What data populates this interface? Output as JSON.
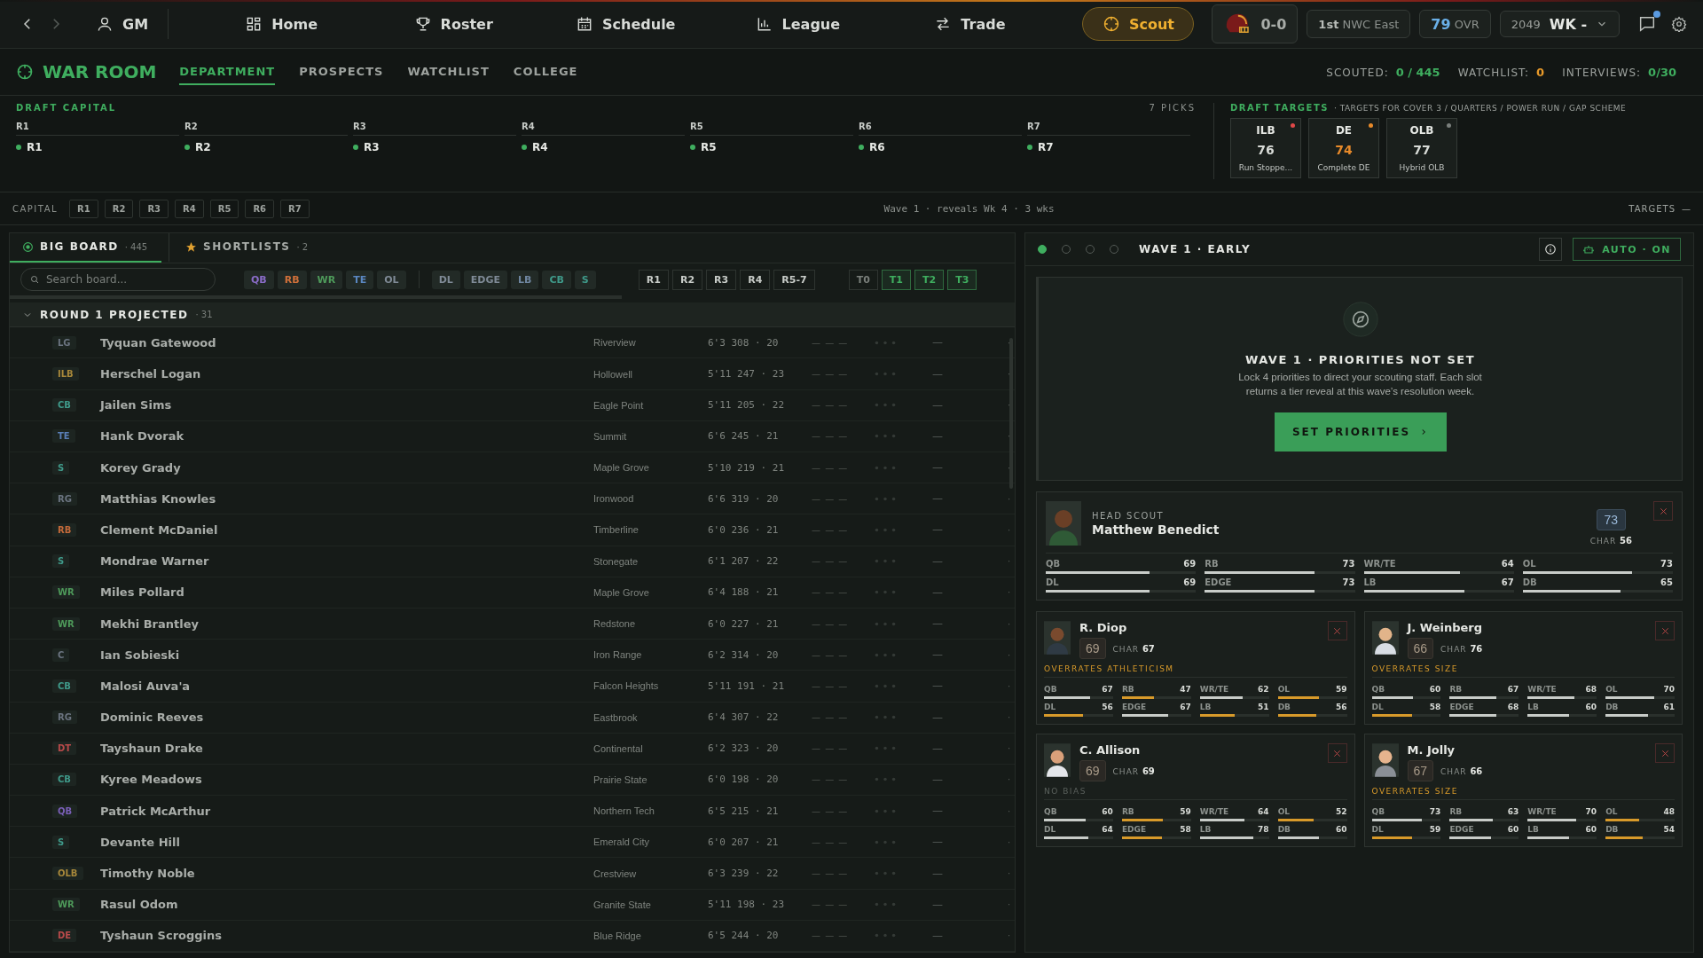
{
  "nav": {
    "items": [
      {
        "label": "GM",
        "selected": false
      },
      {
        "label": "Home",
        "selected": false
      },
      {
        "label": "Roster",
        "selected": false
      },
      {
        "label": "Schedule",
        "selected": false
      },
      {
        "label": "League",
        "selected": false
      },
      {
        "label": "Trade",
        "selected": false
      },
      {
        "label": "Scout",
        "selected": true
      }
    ],
    "record": "0-0",
    "standing": "1st",
    "division": "NWC East",
    "ovr": "79",
    "ovr_label": "OVR",
    "year": "2049",
    "week": "WK -",
    "unread": true
  },
  "war_room": {
    "title": "WAR ROOM",
    "tabs": [
      {
        "label": "DEPARTMENT",
        "selected": true
      },
      {
        "label": "PROSPECTS",
        "selected": false
      },
      {
        "label": "WATCHLIST",
        "selected": false
      },
      {
        "label": "COLLEGE",
        "selected": false
      }
    ],
    "stats": [
      {
        "label": "SCOUTED:",
        "value": "0 / 445",
        "color": "#3fae5f"
      },
      {
        "label": "WATCHLIST:",
        "value": "0",
        "color": "#e89a2a"
      },
      {
        "label": "INTERVIEWS:",
        "value": "0/30",
        "color": "#3fae5f"
      }
    ]
  },
  "draft_capital": {
    "title": "DRAFT CAPITAL",
    "count": "7 PICKS",
    "rounds": [
      {
        "round": "R1",
        "pick": "R1"
      },
      {
        "round": "R2",
        "pick": "R2"
      },
      {
        "round": "R3",
        "pick": "R3"
      },
      {
        "round": "R4",
        "pick": "R4"
      },
      {
        "round": "R5",
        "pick": "R5"
      },
      {
        "round": "R6",
        "pick": "R6"
      },
      {
        "round": "R7",
        "pick": "R7"
      }
    ]
  },
  "draft_targets": {
    "title": "DRAFT TARGETS",
    "subtitle": "· TARGETS FOR COVER 3 / QUARTERS / POWER RUN / GAP SCHEME",
    "targets": [
      {
        "position": "ILB",
        "rating": "76",
        "label": "Run Stoppe...",
        "color": "#e04848",
        "highlighted": false
      },
      {
        "position": "DE",
        "rating": "74",
        "label": "Complete DE",
        "color": "#e88a2a",
        "highlighted": true
      },
      {
        "position": "OLB",
        "rating": "77",
        "label": "Hybrid OLB",
        "color": "#7a7f7c",
        "highlighted": false
      }
    ]
  },
  "capital_bar": {
    "label": "CAPITAL",
    "chips": [
      "R1",
      "R2",
      "R3",
      "R4",
      "R5",
      "R6",
      "R7"
    ],
    "wave_note": "Wave 1 · reveals Wk 4 · 3 wks",
    "targets_label": "TARGETS",
    "targets_toggle": "—"
  },
  "board": {
    "tabs": [
      {
        "label": "BIG BOARD",
        "count": "· 445",
        "selected": true
      },
      {
        "label": "SHORTLISTS",
        "count": "· 2",
        "selected": false
      }
    ],
    "search": {
      "placeholder": "Search board..."
    },
    "offense_filters": [
      {
        "label": "QB",
        "color": "#8a6cc8"
      },
      {
        "label": "RB",
        "color": "#d0703a"
      },
      {
        "label": "WR",
        "color": "#4e9a5a"
      },
      {
        "label": "TE",
        "color": "#5a86c0"
      },
      {
        "label": "OL",
        "color": "#7f8a96"
      }
    ],
    "defense_filters": [
      {
        "label": "DL",
        "color": "#7f8a96"
      },
      {
        "label": "EDGE",
        "color": "#7f8a96"
      },
      {
        "label": "LB",
        "color": "#6f86a0"
      },
      {
        "label": "CB",
        "color": "#3f9a8a"
      },
      {
        "label": "S",
        "color": "#3f9a8a"
      }
    ],
    "round_filters": [
      "R1",
      "R2",
      "R3",
      "R4",
      "R5-7"
    ],
    "tier_filters": [
      {
        "label": "T0",
        "selected": false
      },
      {
        "label": "T1",
        "selected": true
      },
      {
        "label": "T2",
        "selected": true
      },
      {
        "label": "T3",
        "selected": true
      }
    ],
    "group": {
      "title": "ROUND 1 PROJECTED",
      "count": "· 31",
      "expanded": true
    },
    "players": [
      {
        "pos": "LG",
        "color": "#6b7480",
        "name": "Tyquan Gatewood",
        "school": "Riverview",
        "measurables": "6'3 308 · 20",
        "column_5": "— — —",
        "column_7": "—",
        "column_8": "·"
      },
      {
        "pos": "ILB",
        "color": "#a8883a",
        "name": "Herschel Logan",
        "school": "Hollowell",
        "measurables": "5'11 247 · 23",
        "column_5": "— — —",
        "column_7": "—",
        "column_8": "·"
      },
      {
        "pos": "CB",
        "color": "#3f9a8a",
        "name": "Jailen Sims",
        "school": "Eagle Point",
        "measurables": "5'11 205 · 22",
        "column_5": "— — —",
        "column_7": "—",
        "column_8": "·"
      },
      {
        "pos": "TE",
        "color": "#5a7fb8",
        "name": "Hank Dvorak",
        "school": "Summit",
        "measurables": "6'6 245 · 21",
        "column_5": "— — —",
        "column_7": "—",
        "column_8": "·"
      },
      {
        "pos": "S",
        "color": "#3f9a8a",
        "name": "Korey Grady",
        "school": "Maple Grove",
        "measurables": "5'10 219 · 21",
        "column_5": "— — —",
        "column_7": "—",
        "column_8": "·"
      },
      {
        "pos": "RG",
        "color": "#6b7480",
        "name": "Matthias Knowles",
        "school": "Ironwood",
        "measurables": "6'6 319 · 20",
        "column_5": "— — —",
        "column_7": "—",
        "column_8": "·"
      },
      {
        "pos": "RB",
        "color": "#c46a3a",
        "name": "Clement McDaniel",
        "school": "Timberline",
        "measurables": "6'0 236 · 21",
        "column_5": "— — —",
        "column_7": "—",
        "column_8": "·"
      },
      {
        "pos": "S",
        "color": "#3f9a8a",
        "name": "Mondrae Warner",
        "school": "Stonegate",
        "measurables": "6'1 207 · 22",
        "column_5": "— — —",
        "column_7": "—",
        "column_8": "·"
      },
      {
        "pos": "WR",
        "color": "#4e9a5a",
        "name": "Miles Pollard",
        "school": "Maple Grove",
        "measurables": "6'4 188 · 21",
        "column_5": "— — —",
        "column_7": "—",
        "column_8": "·"
      },
      {
        "pos": "WR",
        "color": "#4e9a5a",
        "name": "Mekhi Brantley",
        "school": "Redstone",
        "measurables": "6'0 227 · 21",
        "column_5": "— — —",
        "column_7": "—",
        "column_8": "·"
      },
      {
        "pos": "C",
        "color": "#6b7480",
        "name": "Ian Sobieski",
        "school": "Iron Range",
        "measurables": "6'2 314 · 20",
        "column_5": "— — —",
        "column_7": "—",
        "column_8": "·"
      },
      {
        "pos": "CB",
        "color": "#3f9a8a",
        "name": "Malosi Auva'a",
        "school": "Falcon Heights",
        "measurables": "5'11 191 · 21",
        "column_5": "— — —",
        "column_7": "—",
        "column_8": "·"
      },
      {
        "pos": "RG",
        "color": "#6b7480",
        "name": "Dominic Reeves",
        "school": "Eastbrook",
        "measurables": "6'4 307 · 22",
        "column_5": "— — —",
        "column_7": "—",
        "column_8": "·"
      },
      {
        "pos": "DT",
        "color": "#b84a4a",
        "name": "Tayshaun Drake",
        "school": "Continental",
        "measurables": "6'2 323 · 20",
        "column_5": "— — —",
        "column_7": "—",
        "column_8": "·"
      },
      {
        "pos": "CB",
        "color": "#3f9a8a",
        "name": "Kyree Meadows",
        "school": "Prairie State",
        "measurables": "6'0 198 · 20",
        "column_5": "— — —",
        "column_7": "—",
        "column_8": "·"
      },
      {
        "pos": "QB",
        "color": "#7a5fb8",
        "name": "Patrick McArthur",
        "school": "Northern Tech",
        "measurables": "6'5 215 · 21",
        "column_5": "— — —",
        "column_7": "—",
        "column_8": "·"
      },
      {
        "pos": "S",
        "color": "#3f9a8a",
        "name": "Devante Hill",
        "school": "Emerald City",
        "measurables": "6'0 207 · 21",
        "column_5": "— — —",
        "column_7": "—",
        "column_8": "·"
      },
      {
        "pos": "OLB",
        "color": "#a8883a",
        "name": "Timothy Noble",
        "school": "Crestview",
        "measurables": "6'3 239 · 22",
        "column_5": "— — —",
        "column_7": "—",
        "column_8": "·"
      },
      {
        "pos": "WR",
        "color": "#4e9a5a",
        "name": "Rasul Odom",
        "school": "Granite State",
        "measurables": "5'11 198 · 23",
        "column_5": "— — —",
        "column_7": "—",
        "column_8": "·"
      },
      {
        "pos": "DE",
        "color": "#b84a4a",
        "name": "Tyshaun Scroggins",
        "school": "Blue Ridge",
        "measurables": "6'5 244 · 20",
        "column_5": "— — —",
        "column_7": "—",
        "column_8": "·"
      }
    ]
  },
  "wave": {
    "steps": [
      {
        "done": true
      },
      {
        "done": false
      },
      {
        "done": false
      },
      {
        "done": false
      }
    ],
    "title": "WAVE 1 · EARLY",
    "auto": "AUTO · ON"
  },
  "priorities": {
    "title": "WAVE 1 · PRIORITIES NOT SET",
    "body": "Lock 4 priorities to direct your scouting staff. Each slot returns a tier reveal at this wave’s resolution week.",
    "button": "SET PRIORITIES"
  },
  "head_scout": {
    "role": "HEAD SCOUT",
    "name": "Matthew Benedict",
    "rating": "73",
    "char_label": "CHAR",
    "char": "56",
    "skills": [
      {
        "label": "QB",
        "value": "69",
        "level": 0.69,
        "highlighted": false
      },
      {
        "label": "RB",
        "value": "73",
        "level": 0.73,
        "highlighted": false
      },
      {
        "label": "WR/TE",
        "value": "64",
        "level": 0.64,
        "highlighted": false
      },
      {
        "label": "OL",
        "value": "73",
        "level": 0.73,
        "highlighted": false
      },
      {
        "label": "DL",
        "value": "69",
        "level": 0.69,
        "highlighted": false
      },
      {
        "label": "EDGE",
        "value": "73",
        "level": 0.73,
        "highlighted": false
      },
      {
        "label": "LB",
        "value": "67",
        "level": 0.67,
        "highlighted": false
      },
      {
        "label": "DB",
        "value": "65",
        "level": 0.65,
        "highlighted": false
      }
    ]
  },
  "scouts": [
    {
      "name": "R. Diop",
      "rating": "69",
      "char_label": "CHAR",
      "char": "67",
      "bias": "OVERRATES ATHLETICISM",
      "biased": true,
      "skills": [
        {
          "label": "QB",
          "value": "67",
          "level": 0.67,
          "highlighted": false
        },
        {
          "label": "RB",
          "value": "47",
          "level": 0.47,
          "highlighted": true
        },
        {
          "label": "WR/TE",
          "value": "62",
          "level": 0.62,
          "highlighted": false
        },
        {
          "label": "OL",
          "value": "59",
          "level": 0.59,
          "highlighted": true
        },
        {
          "label": "DL",
          "value": "56",
          "level": 0.56,
          "highlighted": true
        },
        {
          "label": "EDGE",
          "value": "67",
          "level": 0.67,
          "highlighted": false
        },
        {
          "label": "LB",
          "value": "51",
          "level": 0.51,
          "highlighted": true
        },
        {
          "label": "DB",
          "value": "56",
          "level": 0.56,
          "highlighted": true
        }
      ]
    },
    {
      "name": "J. Weinberg",
      "rating": "66",
      "char_label": "CHAR",
      "char": "76",
      "bias": "OVERRATES SIZE",
      "biased": true,
      "skills": [
        {
          "label": "QB",
          "value": "60",
          "level": 0.6,
          "highlighted": false
        },
        {
          "label": "RB",
          "value": "67",
          "level": 0.67,
          "highlighted": false
        },
        {
          "label": "WR/TE",
          "value": "68",
          "level": 0.68,
          "highlighted": false
        },
        {
          "label": "OL",
          "value": "70",
          "level": 0.7,
          "highlighted": false
        },
        {
          "label": "DL",
          "value": "58",
          "level": 0.58,
          "highlighted": true
        },
        {
          "label": "EDGE",
          "value": "68",
          "level": 0.68,
          "highlighted": false
        },
        {
          "label": "LB",
          "value": "60",
          "level": 0.6,
          "highlighted": false
        },
        {
          "label": "DB",
          "value": "61",
          "level": 0.61,
          "highlighted": false
        }
      ]
    },
    {
      "name": "C. Allison",
      "rating": "69",
      "char_label": "CHAR",
      "char": "69",
      "bias": "NO BIAS",
      "biased": false,
      "skills": [
        {
          "label": "QB",
          "value": "60",
          "level": 0.6,
          "highlighted": false
        },
        {
          "label": "RB",
          "value": "59",
          "level": 0.59,
          "highlighted": true
        },
        {
          "label": "WR/TE",
          "value": "64",
          "level": 0.64,
          "highlighted": false
        },
        {
          "label": "OL",
          "value": "52",
          "level": 0.52,
          "highlighted": true
        },
        {
          "label": "DL",
          "value": "64",
          "level": 0.64,
          "highlighted": false
        },
        {
          "label": "EDGE",
          "value": "58",
          "level": 0.58,
          "highlighted": true
        },
        {
          "label": "LB",
          "value": "78",
          "level": 0.78,
          "highlighted": false
        },
        {
          "label": "DB",
          "value": "60",
          "level": 0.6,
          "highlighted": false
        }
      ]
    },
    {
      "name": "M. Jolly",
      "rating": "67",
      "char_label": "CHAR",
      "char": "66",
      "bias": "OVERRATES SIZE",
      "biased": true,
      "skills": [
        {
          "label": "QB",
          "value": "73",
          "level": 0.73,
          "highlighted": false
        },
        {
          "label": "RB",
          "value": "63",
          "level": 0.63,
          "highlighted": false
        },
        {
          "label": "WR/TE",
          "value": "70",
          "level": 0.7,
          "highlighted": false
        },
        {
          "label": "OL",
          "value": "48",
          "level": 0.48,
          "highlighted": true
        },
        {
          "label": "DL",
          "value": "59",
          "level": 0.59,
          "highlighted": true
        },
        {
          "label": "EDGE",
          "value": "60",
          "level": 0.6,
          "highlighted": false
        },
        {
          "label": "LB",
          "value": "60",
          "level": 0.6,
          "highlighted": false
        },
        {
          "label": "DB",
          "value": "54",
          "level": 0.54,
          "highlighted": true
        }
      ]
    }
  ]
}
